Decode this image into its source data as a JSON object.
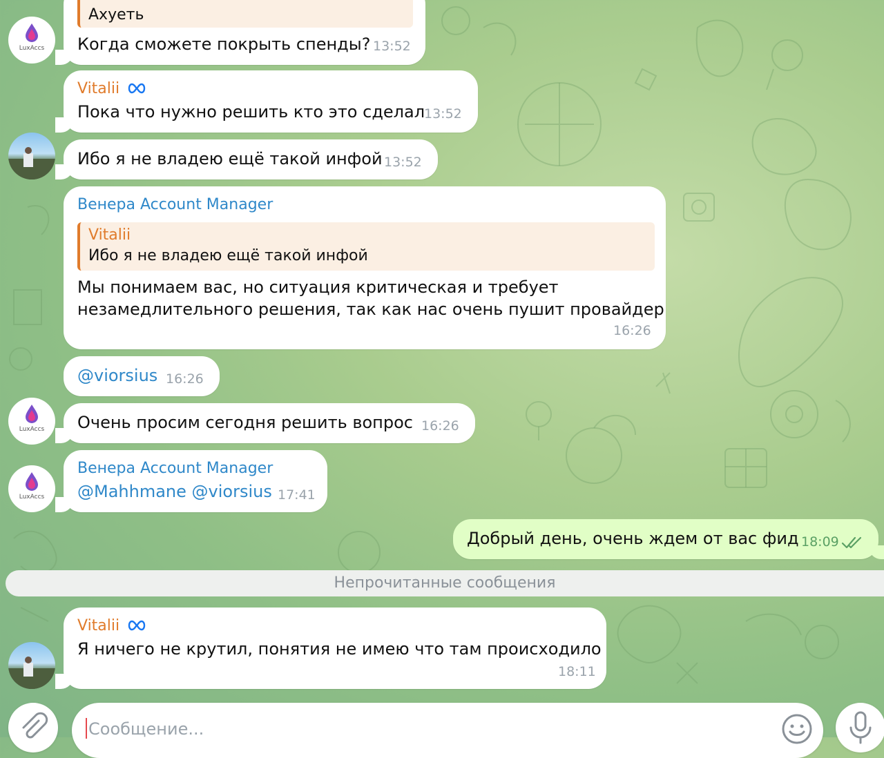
{
  "chat": {
    "messages": [
      {
        "quote_text": "Ахуеть",
        "text": "Когда сможете покрыть спенды?",
        "time": "13:52"
      },
      {
        "sender": "Vitalii",
        "text": "Пока что нужно решить кто это сделал",
        "time": "13:52"
      },
      {
        "text": "Ибо я не владею ещё такой инфой",
        "time": "13:52"
      },
      {
        "sender": "Венера Account Manager",
        "quote_sender": "Vitalii",
        "quote_text": "Ибо я не владею ещё такой инфой",
        "text_line1": "Мы понимаем вас, но ситуация критическая и требует",
        "text_line2": "незамедлительного решения, так как нас очень пушит провайдер",
        "time": "16:26"
      },
      {
        "text": "@viorsius",
        "time": "16:26"
      },
      {
        "text": "Очень просим сегодня решить вопрос",
        "time": "16:26"
      },
      {
        "sender": "Венера Account Manager",
        "text": "@Mahhmane @viorsius",
        "time": "17:41"
      },
      {
        "text": "Добрый день, очень ждем от вас фид",
        "time": "18:09",
        "outgoing": true,
        "status": "read"
      },
      {
        "sender": "Vitalii",
        "text": "Я ничего не крутил, понятия не имею что там происходило",
        "time": "18:11"
      }
    ],
    "unread_divider": "Непрочитанные сообщения"
  },
  "avatars": {
    "lux_label": "LuxAccs"
  },
  "composer": {
    "placeholder": "Сообщение..."
  },
  "icons": {
    "attach": "paperclip-icon",
    "emoji": "emoji-icon",
    "mic": "microphone-icon",
    "meta": "meta-verified-icon",
    "read": "double-check-icon"
  },
  "colors": {
    "sender_orange": "#e07b2b",
    "sender_blue": "#2f88c9",
    "outgoing_bubble": "#e1fec6"
  }
}
